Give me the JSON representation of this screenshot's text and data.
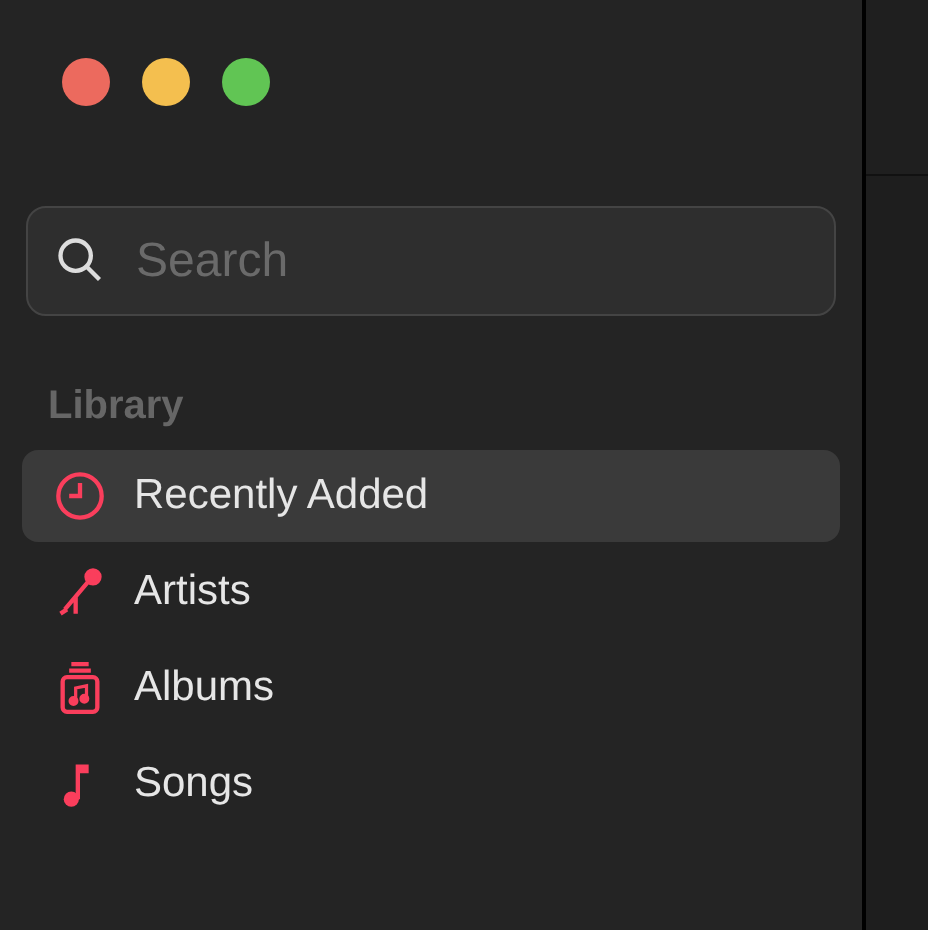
{
  "window_controls": [
    {
      "color": "#ec6a5e"
    },
    {
      "color": "#f4bf4f"
    },
    {
      "color": "#61c554"
    }
  ],
  "search": {
    "placeholder": "Search"
  },
  "sidebar": {
    "section": "Library",
    "items": [
      {
        "label": "Recently Added",
        "kind": "clock",
        "selected": true
      },
      {
        "label": "Artists",
        "kind": "microphone",
        "selected": false
      },
      {
        "label": "Albums",
        "kind": "album",
        "selected": false
      },
      {
        "label": "Songs",
        "kind": "note",
        "selected": false
      }
    ]
  }
}
